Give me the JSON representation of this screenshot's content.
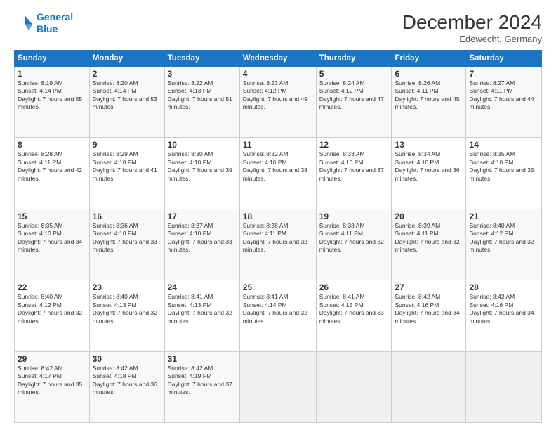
{
  "header": {
    "logo_line1": "General",
    "logo_line2": "Blue",
    "main_title": "December 2024",
    "subtitle": "Edewecht, Germany"
  },
  "days_of_week": [
    "Sunday",
    "Monday",
    "Tuesday",
    "Wednesday",
    "Thursday",
    "Friday",
    "Saturday"
  ],
  "weeks": [
    [
      {
        "day": 1,
        "sunrise": "8:19 AM",
        "sunset": "4:14 PM",
        "daylight": "7 hours and 55 minutes."
      },
      {
        "day": 2,
        "sunrise": "8:20 AM",
        "sunset": "4:14 PM",
        "daylight": "7 hours and 53 minutes."
      },
      {
        "day": 3,
        "sunrise": "8:22 AM",
        "sunset": "4:13 PM",
        "daylight": "7 hours and 51 minutes."
      },
      {
        "day": 4,
        "sunrise": "8:23 AM",
        "sunset": "4:12 PM",
        "daylight": "7 hours and 49 minutes."
      },
      {
        "day": 5,
        "sunrise": "8:24 AM",
        "sunset": "4:12 PM",
        "daylight": "7 hours and 47 minutes."
      },
      {
        "day": 6,
        "sunrise": "8:26 AM",
        "sunset": "4:11 PM",
        "daylight": "7 hours and 45 minutes."
      },
      {
        "day": 7,
        "sunrise": "8:27 AM",
        "sunset": "4:11 PM",
        "daylight": "7 hours and 44 minutes."
      }
    ],
    [
      {
        "day": 8,
        "sunrise": "8:28 AM",
        "sunset": "4:11 PM",
        "daylight": "7 hours and 42 minutes."
      },
      {
        "day": 9,
        "sunrise": "8:29 AM",
        "sunset": "4:10 PM",
        "daylight": "7 hours and 41 minutes."
      },
      {
        "day": 10,
        "sunrise": "8:30 AM",
        "sunset": "4:10 PM",
        "daylight": "7 hours and 39 minutes."
      },
      {
        "day": 11,
        "sunrise": "8:32 AM",
        "sunset": "4:10 PM",
        "daylight": "7 hours and 38 minutes."
      },
      {
        "day": 12,
        "sunrise": "8:33 AM",
        "sunset": "4:10 PM",
        "daylight": "7 hours and 37 minutes."
      },
      {
        "day": 13,
        "sunrise": "8:34 AM",
        "sunset": "4:10 PM",
        "daylight": "7 hours and 36 minutes."
      },
      {
        "day": 14,
        "sunrise": "8:35 AM",
        "sunset": "4:10 PM",
        "daylight": "7 hours and 35 minutes."
      }
    ],
    [
      {
        "day": 15,
        "sunrise": "8:35 AM",
        "sunset": "4:10 PM",
        "daylight": "7 hours and 34 minutes."
      },
      {
        "day": 16,
        "sunrise": "8:36 AM",
        "sunset": "4:10 PM",
        "daylight": "7 hours and 33 minutes."
      },
      {
        "day": 17,
        "sunrise": "8:37 AM",
        "sunset": "4:10 PM",
        "daylight": "7 hours and 33 minutes."
      },
      {
        "day": 18,
        "sunrise": "8:38 AM",
        "sunset": "4:11 PM",
        "daylight": "7 hours and 32 minutes."
      },
      {
        "day": 19,
        "sunrise": "8:38 AM",
        "sunset": "4:11 PM",
        "daylight": "7 hours and 32 minutes."
      },
      {
        "day": 20,
        "sunrise": "8:39 AM",
        "sunset": "4:11 PM",
        "daylight": "7 hours and 32 minutes."
      },
      {
        "day": 21,
        "sunrise": "8:40 AM",
        "sunset": "4:12 PM",
        "daylight": "7 hours and 32 minutes."
      }
    ],
    [
      {
        "day": 22,
        "sunrise": "8:40 AM",
        "sunset": "4:12 PM",
        "daylight": "7 hours and 32 minutes."
      },
      {
        "day": 23,
        "sunrise": "8:40 AM",
        "sunset": "4:13 PM",
        "daylight": "7 hours and 32 minutes."
      },
      {
        "day": 24,
        "sunrise": "8:41 AM",
        "sunset": "4:13 PM",
        "daylight": "7 hours and 32 minutes."
      },
      {
        "day": 25,
        "sunrise": "8:41 AM",
        "sunset": "4:14 PM",
        "daylight": "7 hours and 32 minutes."
      },
      {
        "day": 26,
        "sunrise": "8:41 AM",
        "sunset": "4:15 PM",
        "daylight": "7 hours and 33 minutes."
      },
      {
        "day": 27,
        "sunrise": "8:42 AM",
        "sunset": "4:16 PM",
        "daylight": "7 hours and 34 minutes."
      },
      {
        "day": 28,
        "sunrise": "8:42 AM",
        "sunset": "4:16 PM",
        "daylight": "7 hours and 34 minutes."
      }
    ],
    [
      {
        "day": 29,
        "sunrise": "8:42 AM",
        "sunset": "4:17 PM",
        "daylight": "7 hours and 35 minutes."
      },
      {
        "day": 30,
        "sunrise": "8:42 AM",
        "sunset": "4:18 PM",
        "daylight": "7 hours and 36 minutes."
      },
      {
        "day": 31,
        "sunrise": "8:42 AM",
        "sunset": "4:19 PM",
        "daylight": "7 hours and 37 minutes."
      },
      null,
      null,
      null,
      null
    ]
  ]
}
